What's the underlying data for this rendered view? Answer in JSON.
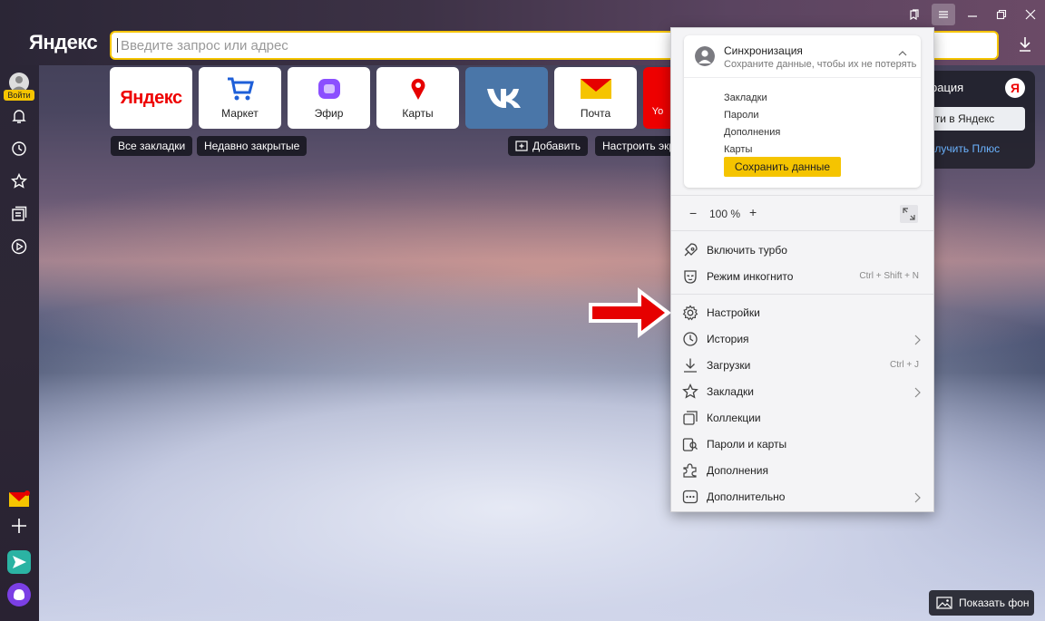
{
  "header": {
    "logo": "Яндекс",
    "search_placeholder": "Введите запрос или адрес"
  },
  "sidebar": {
    "login_label": "Войти"
  },
  "tiles": [
    {
      "label": "",
      "logo": "Яндекс"
    },
    {
      "label": "Маркет"
    },
    {
      "label": "Эфир"
    },
    {
      "label": "Карты"
    },
    {
      "label": ""
    },
    {
      "label": "Почта"
    },
    {
      "label": "Yo"
    }
  ],
  "bookmarks_bar": {
    "all_bookmarks": "Все закладки",
    "recently_closed": "Недавно закрытые",
    "add": "Добавить",
    "customize": "Настроить экр"
  },
  "sync_panel_right": {
    "title": "рация",
    "login": "йти в Яндекс",
    "plus": "олучить Плюс",
    "ya_logo": "Я"
  },
  "menu": {
    "sync": {
      "title": "Синхронизация",
      "subtitle": "Сохраните данные, чтобы их не потерять",
      "items": [
        "Закладки",
        "Пароли",
        "Дополнения",
        "Карты"
      ],
      "save_button": "Сохранить данные"
    },
    "zoom": {
      "minus": "−",
      "value": "100 %",
      "plus": "+"
    },
    "items": [
      {
        "label": "Включить турбо",
        "shortcut": ""
      },
      {
        "label": "Режим инкогнито",
        "shortcut": "Ctrl + Shift + N"
      },
      {
        "label": "Настройки",
        "shortcut": ""
      },
      {
        "label": "История",
        "shortcut": ""
      },
      {
        "label": "Загрузки",
        "shortcut": "Ctrl + J"
      },
      {
        "label": "Закладки",
        "shortcut": ""
      },
      {
        "label": "Коллекции",
        "shortcut": ""
      },
      {
        "label": "Пароли и карты",
        "shortcut": ""
      },
      {
        "label": "Дополнения",
        "shortcut": ""
      },
      {
        "label": "Дополнительно",
        "shortcut": ""
      }
    ]
  },
  "footer": {
    "show_background": "Показать фон"
  },
  "colors": {
    "accent_yellow": "#f5c400",
    "arrow_red": "#e60000",
    "vk_blue": "#4a76a8"
  }
}
